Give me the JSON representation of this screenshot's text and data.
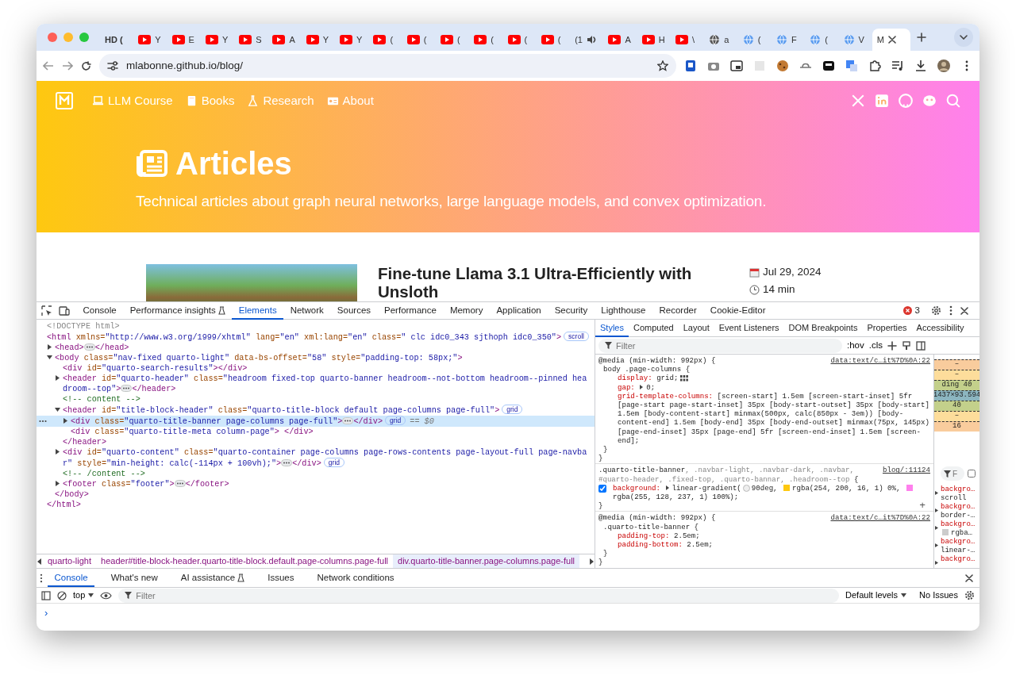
{
  "browser": {
    "tabs": [
      {
        "kind": "none",
        "title": "HD (",
        "selected": false
      },
      {
        "kind": "youtube",
        "title": "Y",
        "selected": false
      },
      {
        "kind": "youtube",
        "title": "E",
        "selected": false
      },
      {
        "kind": "youtube",
        "title": "Y",
        "selected": false
      },
      {
        "kind": "youtube",
        "title": "S",
        "selected": false
      },
      {
        "kind": "youtube",
        "title": "A",
        "selected": false
      },
      {
        "kind": "youtube",
        "title": "Y",
        "selected": false
      },
      {
        "kind": "youtube",
        "title": "Y",
        "selected": false
      },
      {
        "kind": "youtube",
        "title": "(",
        "selected": false
      },
      {
        "kind": "youtube",
        "title": "(",
        "selected": false
      },
      {
        "kind": "youtube",
        "title": "(",
        "selected": false
      },
      {
        "kind": "youtube",
        "title": "(",
        "selected": false
      },
      {
        "kind": "youtube",
        "title": "(",
        "selected": false
      },
      {
        "kind": "youtube",
        "title": "(",
        "selected": false
      },
      {
        "kind": "audio",
        "title": "(1",
        "selected": false
      },
      {
        "kind": "youtube",
        "title": "A",
        "selected": false
      },
      {
        "kind": "youtube",
        "title": "H",
        "selected": false
      },
      {
        "kind": "youtube",
        "title": "\\",
        "selected": false
      },
      {
        "kind": "globe",
        "title": "a",
        "selected": false
      },
      {
        "kind": "web",
        "title": "(",
        "selected": false
      },
      {
        "kind": "web",
        "title": "F",
        "selected": false
      },
      {
        "kind": "web",
        "title": "(",
        "selected": false
      },
      {
        "kind": "web",
        "title": "V",
        "selected": false
      },
      {
        "kind": "none",
        "title": "M",
        "selected": true
      }
    ],
    "address": "mlabonne.github.io/blog/"
  },
  "page": {
    "nav_links": [
      {
        "kind": "laptop",
        "label": "LLM Course"
      },
      {
        "kind": "book",
        "label": "Books"
      },
      {
        "kind": "flask",
        "label": "Research"
      },
      {
        "kind": "card",
        "label": "About"
      }
    ],
    "title": "Articles",
    "subtitle": "Technical articles about graph neural networks, large language models, and convex optimization.",
    "post": {
      "title": "Fine-tune Llama 3.1 Ultra-Efficiently with Unsloth",
      "date": "Jul 29, 2024",
      "read_time": "14 min"
    }
  },
  "devtools": {
    "tabs": [
      {
        "label": "Console",
        "kind": "plain",
        "selected": false
      },
      {
        "label": "Performance insights",
        "kind": "beta",
        "selected": false
      },
      {
        "label": "Elements",
        "kind": "plain",
        "selected": true
      },
      {
        "label": "Network",
        "kind": "plain",
        "selected": false
      },
      {
        "label": "Sources",
        "kind": "plain",
        "selected": false
      },
      {
        "label": "Performance",
        "kind": "plain",
        "selected": false
      },
      {
        "label": "Memory",
        "kind": "plain",
        "selected": false
      },
      {
        "label": "Application",
        "kind": "plain",
        "selected": false
      },
      {
        "label": "Security",
        "kind": "plain",
        "selected": false
      },
      {
        "label": "Lighthouse",
        "kind": "plain",
        "selected": false
      },
      {
        "label": "Recorder",
        "kind": "plain",
        "selected": false
      },
      {
        "label": "Cookie-Editor",
        "kind": "plain",
        "selected": false
      }
    ],
    "error_count": "3",
    "elements": {
      "nodes": [
        {
          "segments": [
            {
              "kind": "doctype",
              "text": "<!DOCTYPE html>"
            }
          ],
          "selected": false
        },
        {
          "segments": [
            {
              "kind": "tag",
              "text": "<html"
            },
            {
              "kind": "attr",
              "text": " xmlns="
            },
            {
              "kind": "value",
              "text": "\"http://www.w3.org/1999/xhtml\""
            },
            {
              "kind": "attr",
              "text": " lang="
            },
            {
              "kind": "value",
              "text": "\"en\""
            },
            {
              "kind": "attr",
              "text": " xml:lang="
            },
            {
              "kind": "value",
              "text": "\"en\""
            },
            {
              "kind": "attr",
              "text": " class="
            },
            {
              "kind": "value",
              "text": "\" clc idc0_343 sjthoph idc0_350\""
            },
            {
              "kind": "tag",
              "text": ">"
            }
          ],
          "badge": "scroll",
          "selected": false,
          "children": [
            {
              "segments": [
                {
                  "kind": "tag",
                  "text": "<head>"
                },
                {
                  "kind": "ellipsis"
                },
                {
                  "kind": "tag",
                  "text": "</head>"
                }
              ],
              "expanded": false,
              "selected": false
            },
            {
              "segments": [
                {
                  "kind": "tag",
                  "text": "<body"
                },
                {
                  "kind": "attr",
                  "text": " class="
                },
                {
                  "kind": "value",
                  "text": "\"nav-fixed quarto-light\""
                },
                {
                  "kind": "attr",
                  "text": " data-bs-offset="
                },
                {
                  "kind": "value",
                  "text": "\"58\""
                },
                {
                  "kind": "attr",
                  "text": " style="
                },
                {
                  "kind": "value",
                  "text": "\"padding-top: 58px;\""
                },
                {
                  "kind": "tag",
                  "text": ">"
                }
              ],
              "expanded": true,
              "selected": false,
              "children": [
                {
                  "segments": [
                    {
                      "kind": "tag",
                      "text": "<div"
                    },
                    {
                      "kind": "attr",
                      "text": " id="
                    },
                    {
                      "kind": "value",
                      "text": "\"quarto-search-results\""
                    },
                    {
                      "kind": "tag",
                      "text": "></div>"
                    }
                  ],
                  "selected": false
                },
                {
                  "segments": [
                    {
                      "kind": "tag",
                      "text": "<header"
                    },
                    {
                      "kind": "attr",
                      "text": " id="
                    },
                    {
                      "kind": "value",
                      "text": "\"quarto-header\""
                    },
                    {
                      "kind": "attr",
                      "text": " class="
                    },
                    {
                      "kind": "value",
                      "text": "\"headroom fixed-top quarto-banner headroom--not-bottom headroom--pinned headroom--top\""
                    },
                    {
                      "kind": "tag",
                      "text": ">"
                    },
                    {
                      "kind": "ellipsis"
                    },
                    {
                      "kind": "tag",
                      "text": "</header>"
                    }
                  ],
                  "expanded": false,
                  "selected": false
                },
                {
                  "segments": [
                    {
                      "kind": "comment",
                      "text": "<!-- content -->"
                    }
                  ],
                  "selected": false
                },
                {
                  "segments": [
                    {
                      "kind": "tag",
                      "text": "<header"
                    },
                    {
                      "kind": "attr",
                      "text": " id="
                    },
                    {
                      "kind": "value",
                      "text": "\"title-block-header\""
                    },
                    {
                      "kind": "attr",
                      "text": " class="
                    },
                    {
                      "kind": "value",
                      "text": "\"quarto-title-block default page-columns page-full\""
                    },
                    {
                      "kind": "tag",
                      "text": ">"
                    }
                  ],
                  "badge": "grid",
                  "expanded": true,
                  "selected": false,
                  "children": [
                    {
                      "segments": [
                        {
                          "kind": "tag",
                          "text": "<div"
                        },
                        {
                          "kind": "attr",
                          "text": " class="
                        },
                        {
                          "kind": "value",
                          "text": "\"quarto-title-banner page-columns page-full\""
                        },
                        {
                          "kind": "tag",
                          "text": ">"
                        },
                        {
                          "kind": "ellipsis"
                        },
                        {
                          "kind": "tag",
                          "text": "</div>"
                        }
                      ],
                      "badge": "grid",
                      "suffix": "== $0",
                      "expanded": false,
                      "selected": true
                    },
                    {
                      "segments": [
                        {
                          "kind": "tag",
                          "text": "<div"
                        },
                        {
                          "kind": "attr",
                          "text": " class="
                        },
                        {
                          "kind": "value",
                          "text": "\"quarto-title-meta column-page\""
                        },
                        {
                          "kind": "tag",
                          "text": "> </div>"
                        }
                      ],
                      "selected": false
                    }
                  ],
                  "close": "</header>"
                },
                {
                  "segments": [
                    {
                      "kind": "tag",
                      "text": "<div"
                    },
                    {
                      "kind": "attr",
                      "text": " id="
                    },
                    {
                      "kind": "value",
                      "text": "\"quarto-content\""
                    },
                    {
                      "kind": "attr",
                      "text": " class="
                    },
                    {
                      "kind": "value",
                      "text": "\"quarto-container page-columns page-rows-contents page-layout-full page-navbar\""
                    },
                    {
                      "kind": "attr",
                      "text": " style="
                    },
                    {
                      "kind": "value",
                      "text": "\"min-height: calc(-114px + 100vh);\""
                    },
                    {
                      "kind": "tag",
                      "text": ">"
                    },
                    {
                      "kind": "ellipsis"
                    },
                    {
                      "kind": "tag",
                      "text": "</div>"
                    }
                  ],
                  "badge": "grid",
                  "expanded": false,
                  "selected": false
                },
                {
                  "segments": [
                    {
                      "kind": "comment",
                      "text": "<!-- /content -->"
                    }
                  ],
                  "selected": false
                },
                {
                  "segments": [
                    {
                      "kind": "tag",
                      "text": "<footer"
                    },
                    {
                      "kind": "attr",
                      "text": " class="
                    },
                    {
                      "kind": "value",
                      "text": "\"footer\""
                    },
                    {
                      "kind": "tag",
                      "text": ">"
                    },
                    {
                      "kind": "ellipsis"
                    },
                    {
                      "kind": "tag",
                      "text": "</footer>"
                    }
                  ],
                  "expanded": false,
                  "selected": false
                }
              ],
              "close": "</body>"
            }
          ],
          "close": "</html>"
        }
      ]
    },
    "breadcrumbs": [
      {
        "label": "quarto-light",
        "selected": false
      },
      {
        "label": "header#title-block-header.quarto-title-block.default.page-columns.page-full",
        "selected": false
      },
      {
        "label": "div.quarto-title-banner.page-columns.page-full",
        "selected": true
      }
    ],
    "side_tabs": [
      {
        "label": "Styles",
        "selected": true
      },
      {
        "label": "Computed",
        "selected": false
      },
      {
        "label": "Layout",
        "selected": false
      },
      {
        "label": "Event Listeners",
        "selected": false
      },
      {
        "label": "DOM Breakpoints",
        "selected": false
      },
      {
        "label": "Properties",
        "selected": false
      },
      {
        "label": "Accessibility",
        "selected": false
      }
    ],
    "styles_filter": {
      "placeholder": "Filter"
    },
    "hov": ":hov",
    "cls": ".cls",
    "rules": [
      {
        "media": "@media (min-width: 992px) {",
        "source": "data:text/c…it%7D%0A:22",
        "selector": [
          {
            "text": "body .page-columns",
            "matched": true
          },
          {
            "text": " {",
            "matched": true
          }
        ],
        "decls": [
          {
            "name": "display:",
            "value": [
              {
                "kind": "text",
                "text": "grid;"
              },
              {
                "kind": "grid"
              }
            ]
          },
          {
            "name": "gap:",
            "expanded": false,
            "value": [
              {
                "kind": "text",
                "text": "0;"
              }
            ]
          },
          {
            "name": "grid-template-columns:",
            "value": [
              {
                "kind": "text",
                "text": "[screen-start] 1.5em [screen-start-inset] 5fr [page-start page-start-inset] 35px [body-start-outset] 35px [body-start] 1.5em [body-content-start] minmax(500px, calc(850px - 3em)) [body-content-end] 1.5em [body-end] 35px [body-end-outset] minmax(75px, 145px) [page-end-inset] 35px [page-end] 5fr [screen-end-inset] 1.5em [screen-end];"
              }
            ]
          }
        ],
        "close": [
          "}",
          "}"
        ]
      },
      {
        "source": "blog/:11124",
        "selector": [
          {
            "text": ".quarto-title-banner",
            "matched": true
          },
          {
            "text": ", .navbar-light, .navbar-dark, .navbar, #quarto-header, .fixed-top, .quarto-bannar, .headroom--top",
            "matched": false
          },
          {
            "text": " {",
            "matched": true
          }
        ],
        "decls": [
          {
            "name": "background:",
            "checked": true,
            "expanded": false,
            "value": [
              {
                "kind": "text",
                "text": "linear-gradient("
              },
              {
                "kind": "angle"
              },
              {
                "kind": "text",
                "text": "90deg, "
              },
              {
                "kind": "swatch",
                "color": "#fec810"
              },
              {
                "kind": "text",
                "text": "rgba(254, 200, 16, 1) 0%, "
              },
              {
                "kind": "swatch",
                "color": "#ff80ed"
              },
              {
                "kind": "text",
                "text": "rgba(255, 128, 237, 1) 100%);"
              }
            ]
          }
        ],
        "close": [
          "}"
        ],
        "add": "+"
      },
      {
        "media": "@media (min-width: 992px) {",
        "source": "data:text/c…it%7D%0A:22",
        "selector": [
          {
            "text": ".quarto-title-banner",
            "matched": true
          },
          {
            "text": " {",
            "matched": true
          }
        ],
        "decls": [
          {
            "name": "padding-top:",
            "value": [
              {
                "kind": "text",
                "text": "2.5em;"
              }
            ]
          },
          {
            "name": "padding-bottom:",
            "value": [
              {
                "kind": "text",
                "text": "2.5em;"
              }
            ]
          }
        ],
        "close": [
          "}",
          "}"
        ]
      }
    ],
    "box_model": [
      {
        "t": "–",
        "color": "#f9cc9d"
      },
      {
        "t": "–",
        "color": "#fddd9b"
      },
      {
        "t": "ding  40",
        "color": "#c3d08b"
      },
      {
        "t": "1437×93.594",
        "color": "#8cb6c0"
      },
      {
        "t": "40",
        "color": "#c3d08b"
      },
      {
        "t": "–",
        "color": "#fddd9b"
      },
      {
        "t": "16",
        "color": "#f9cc9d"
      }
    ],
    "computed": {
      "placeholder": "F",
      "show_all": false,
      "items": [
        {
          "name": "backgro…",
          "value": "scroll"
        },
        {
          "name": "backgro…",
          "value": "border-…"
        },
        {
          "name": "backgro…",
          "value": "rgba…",
          "swatch": true
        },
        {
          "name": "backgro…",
          "value": "linear-…"
        },
        {
          "name": "backgro…"
        }
      ]
    },
    "drawer": {
      "tabs": [
        {
          "label": "Console",
          "kind": "plain",
          "selected": true
        },
        {
          "label": "What's new",
          "kind": "plain",
          "selected": false
        },
        {
          "label": "AI assistance",
          "kind": "beta",
          "selected": false
        },
        {
          "label": "Issues",
          "kind": "plain",
          "selected": false
        },
        {
          "label": "Network conditions",
          "kind": "plain",
          "selected": false
        }
      ],
      "context": "top",
      "filter_placeholder": "Filter",
      "levels": "Default levels",
      "issues": "No Issues",
      "prompt": "›"
    }
  }
}
